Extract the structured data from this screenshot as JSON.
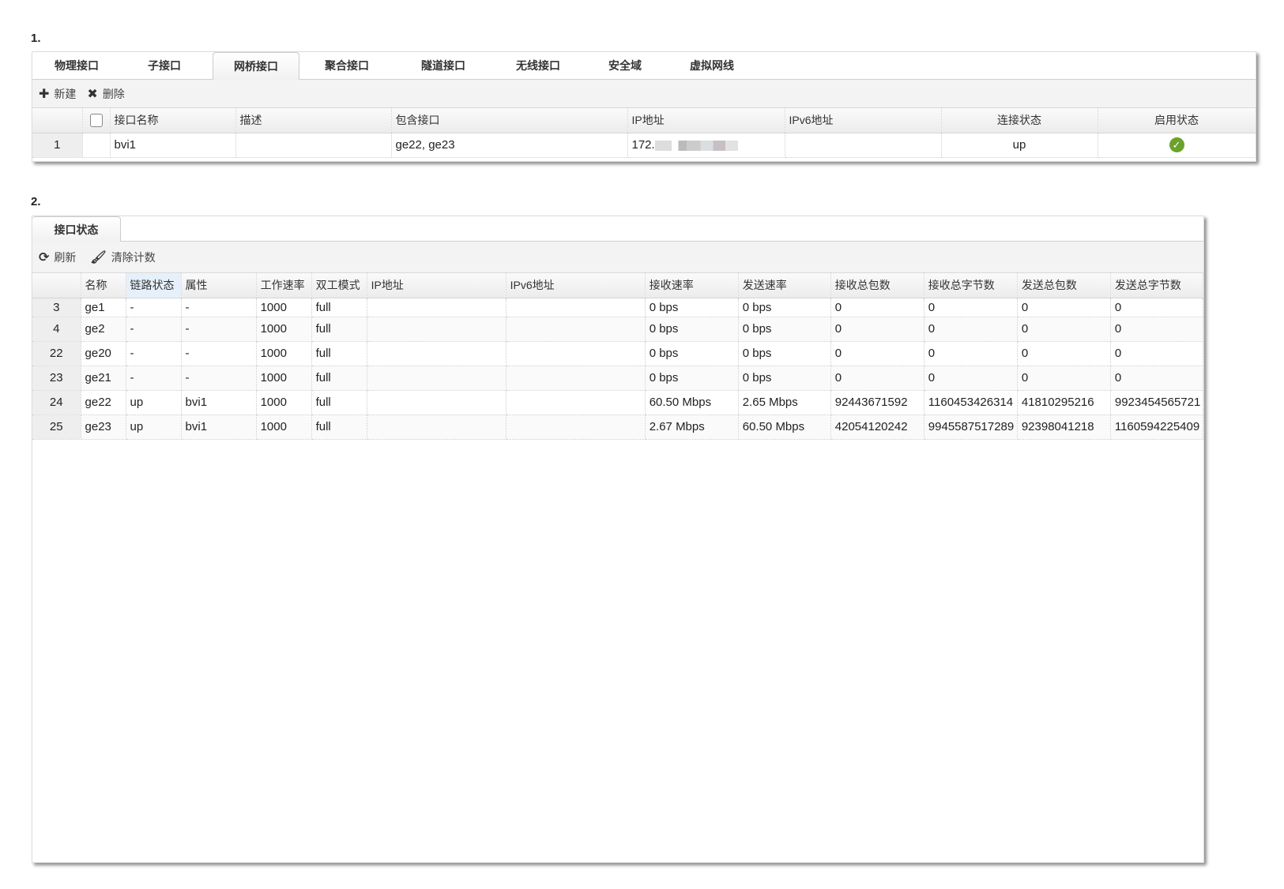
{
  "section1": {
    "label": "1.",
    "tabs": [
      "物理接口",
      "子接口",
      "网桥接口",
      "聚合接口",
      "隧道接口",
      "无线接口",
      "安全域",
      "虚拟网线"
    ],
    "active_tab": 2,
    "toolbar": {
      "new": "新建",
      "delete": "删除"
    },
    "columns": [
      "接口名称",
      "描述",
      "包含接口",
      "IP地址",
      "IPv6地址",
      "连接状态",
      "启用状态"
    ],
    "rows": [
      {
        "num": "1",
        "name": "bvi1",
        "desc": "",
        "members": "ge22, ge23",
        "ip": "172.",
        "ipv6": "",
        "link": "up",
        "enabled": "enabled"
      }
    ]
  },
  "section2": {
    "label": "2.",
    "tab": "接口状态",
    "toolbar": {
      "refresh": "刷新",
      "clear": "清除计数"
    },
    "columns": [
      "名称",
      "链路状态",
      "属性",
      "工作速率",
      "双工模式",
      "IP地址",
      "IPv6地址",
      "接收速率",
      "发送速率",
      "接收总包数",
      "接收总字节数",
      "发送总包数",
      "发送总字节数"
    ],
    "rows": [
      [
        "3",
        "ge1",
        "-",
        "-",
        "1000",
        "full",
        "",
        "",
        "0 bps",
        "0 bps",
        "0",
        "0",
        "0",
        "0"
      ],
      [
        "4",
        "ge2",
        "-",
        "-",
        "1000",
        "full",
        "",
        "",
        "0 bps",
        "0 bps",
        "0",
        "0",
        "0",
        "0"
      ],
      [
        "22",
        "ge20",
        "-",
        "-",
        "1000",
        "full",
        "",
        "",
        "0 bps",
        "0 bps",
        "0",
        "0",
        "0",
        "0"
      ],
      [
        "23",
        "ge21",
        "-",
        "-",
        "1000",
        "full",
        "",
        "",
        "0 bps",
        "0 bps",
        "0",
        "0",
        "0",
        "0"
      ],
      [
        "24",
        "ge22",
        "up",
        "bvi1",
        "1000",
        "full",
        "",
        "",
        "60.50 Mbps",
        "2.65 Mbps",
        "92443671592",
        "1160453426314",
        "41810295216",
        "9923454565721"
      ],
      [
        "25",
        "ge23",
        "up",
        "bvi1",
        "1000",
        "full",
        "",
        "",
        "2.67 Mbps",
        "60.50 Mbps",
        "42054120242",
        "9945587517289",
        "92398041218",
        "1160594225409"
      ]
    ]
  },
  "colors": {
    "check": "#6aa22c",
    "sorted_header": "#e6f0fb"
  }
}
